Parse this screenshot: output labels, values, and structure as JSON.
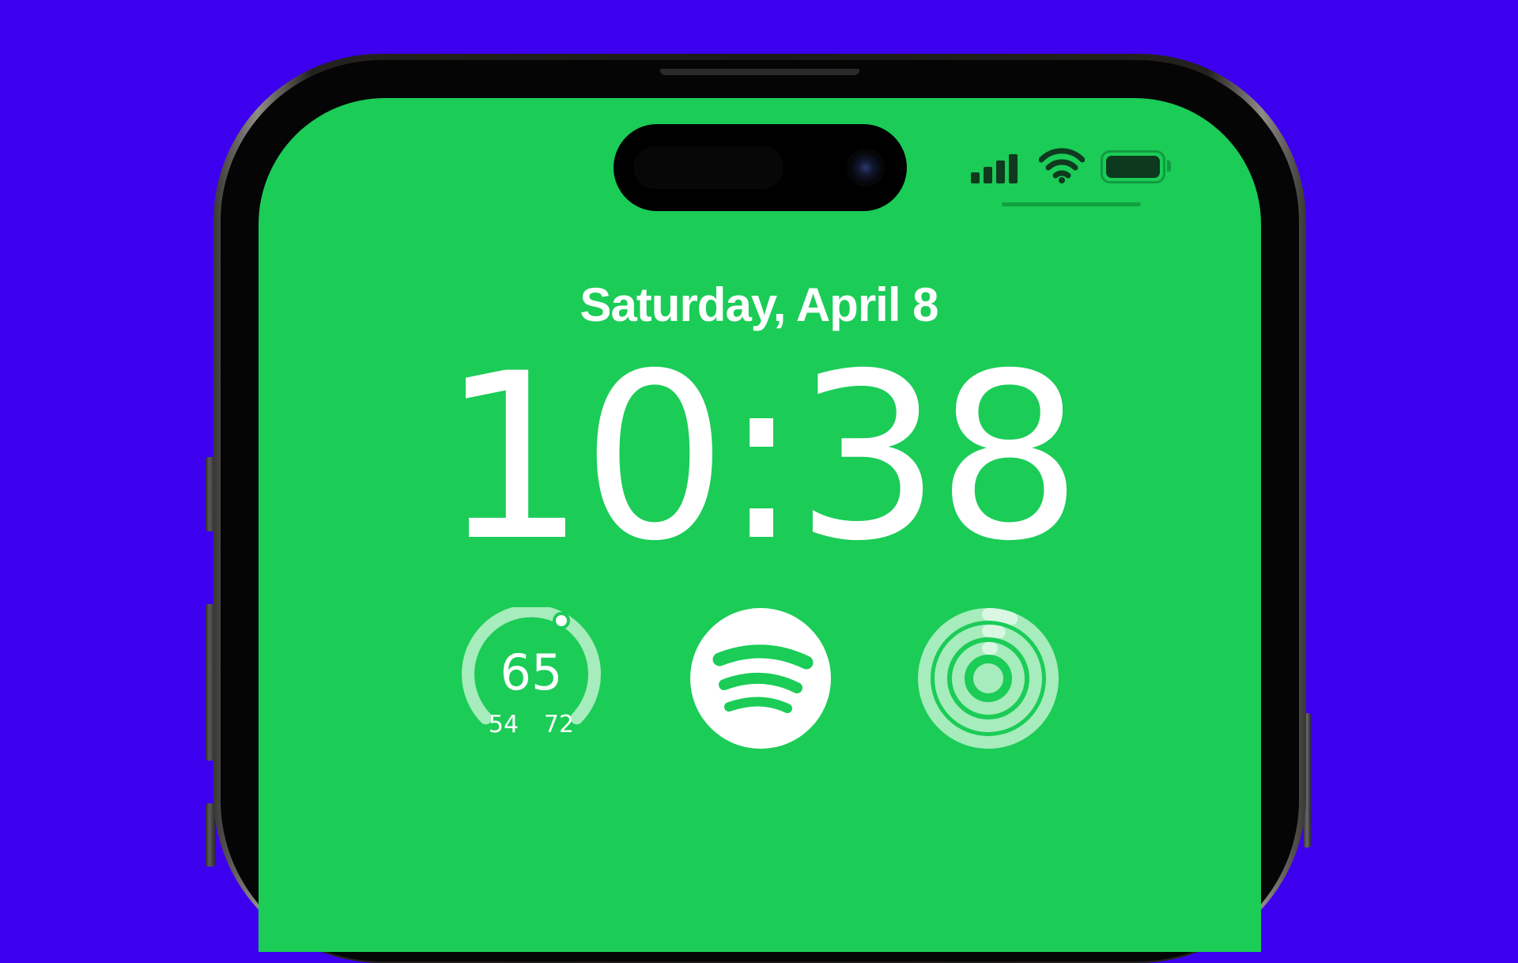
{
  "colors": {
    "background": "#3d00ee",
    "screen": "#1bcc57",
    "widget_dim": "#a6ecbc",
    "icon_dark": "#0f3a1f"
  },
  "lock_screen": {
    "date": "Saturday, April 8",
    "time": "10:38"
  },
  "status_bar": {
    "icons": [
      "cellular-signal-icon",
      "wifi-icon",
      "battery-icon"
    ],
    "signal_bars": 4,
    "battery_level": 1.0
  },
  "widgets": {
    "weather": {
      "current_temp": "65",
      "low_temp": "54",
      "high_temp": "72"
    },
    "spotify": {
      "icon": "spotify-icon"
    },
    "activity": {
      "icon": "activity-rings-icon"
    }
  }
}
